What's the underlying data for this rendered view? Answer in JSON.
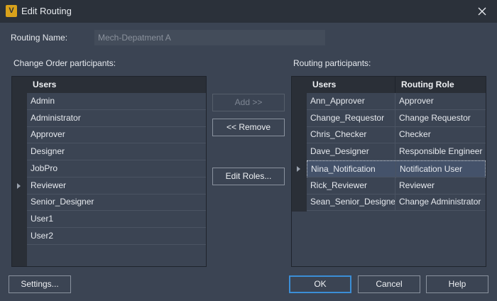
{
  "window": {
    "title": "Edit Routing",
    "app_icon_letter": "V",
    "close_glyph": "close-icon"
  },
  "routing_name": {
    "label": "Routing Name:",
    "value": "Mech-Depatment A"
  },
  "left_panel": {
    "label": "Change Order participants:",
    "column_header": "Users",
    "users": [
      "Admin",
      "Administrator",
      "Approver",
      "Designer",
      "JobPro",
      "Reviewer",
      "Senior_Designer",
      "User1",
      "User2"
    ],
    "current_row_index": 5
  },
  "middle_buttons": {
    "add": "Add >>",
    "remove": "<< Remove",
    "edit_roles": "Edit Roles..."
  },
  "right_panel": {
    "label": "Routing participants:",
    "columns": [
      "Users",
      "Routing Role"
    ],
    "rows": [
      {
        "user": "Ann_Approver",
        "role": "Approver"
      },
      {
        "user": "Change_Requestor",
        "role": "Change Requestor"
      },
      {
        "user": "Chris_Checker",
        "role": "Checker"
      },
      {
        "user": "Dave_Designer",
        "role": "Responsible Engineer"
      },
      {
        "user": "Nina_Notification",
        "role": "Notification User"
      },
      {
        "user": "Rick_Reviewer",
        "role": "Reviewer"
      },
      {
        "user": "Sean_Senior_Designer",
        "role": "Change Administrator"
      }
    ],
    "selected_row_index": 4
  },
  "footer": {
    "settings": "Settings...",
    "ok": "OK",
    "cancel": "Cancel",
    "help": "Help"
  },
  "colors": {
    "background": "#3b4453",
    "header": "#2a2f37",
    "accent": "#3b8ed6",
    "app_icon": "#d9a21b"
  }
}
